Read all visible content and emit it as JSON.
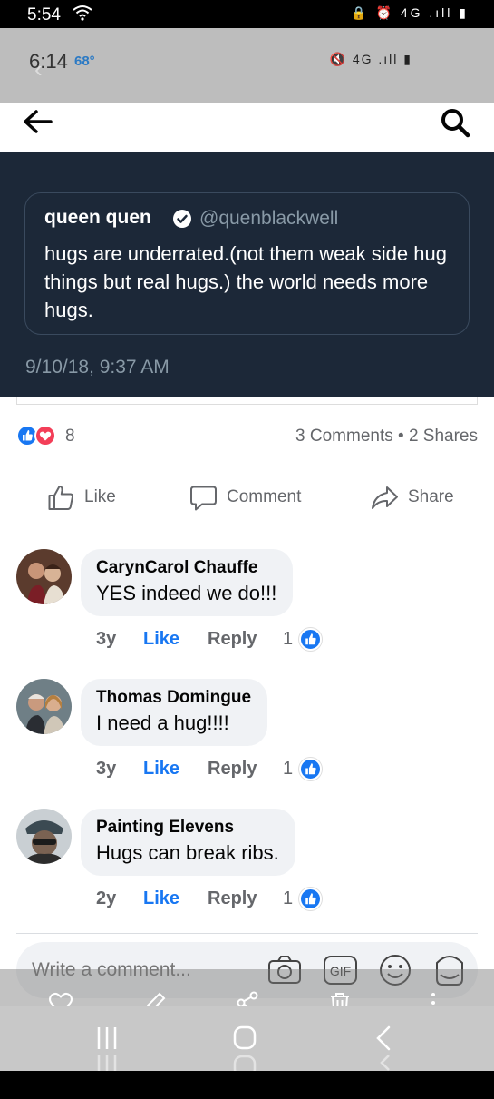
{
  "status_bar": {
    "time": "5:54",
    "wifi_icon": "wifi-icon",
    "sys_icons": "🔒 ⏰ 4G .ıll ▮"
  },
  "inner_status": {
    "time": "6:14",
    "temp": "68°",
    "icons": "🔇 4G .ıll ▮"
  },
  "tweet": {
    "author": "queen quen",
    "handle": "@quenblackwell",
    "text": "hugs are underrated.(not them weak side hug things but real hugs.) the world needs more hugs.",
    "date": "9/10/18, 9:37 AM"
  },
  "post": {
    "reaction_count": "8",
    "stats": "3 Comments • 2 Shares",
    "actions": {
      "like": "Like",
      "comment": "Comment",
      "share": "Share"
    }
  },
  "comments": [
    {
      "name": "CarynCarol Chauffe",
      "text": "YES indeed we do!!!",
      "age": "3y",
      "like": "Like",
      "reply": "Reply",
      "reactions": "1"
    },
    {
      "name": "Thomas Domingue",
      "text": "I need a hug!!!!",
      "age": "3y",
      "like": "Like",
      "reply": "Reply",
      "reactions": "1"
    },
    {
      "name": "Painting Elevens",
      "text": "Hugs can break ribs.",
      "age": "2y",
      "like": "Like",
      "reply": "Reply",
      "reactions": "1"
    }
  ],
  "composer": {
    "placeholder": "Write a comment...",
    "gif": "GIF"
  },
  "colors": {
    "facebook_blue": "#1877f2",
    "love_red": "#f33e58",
    "tweet_bg": "#1c2838"
  }
}
